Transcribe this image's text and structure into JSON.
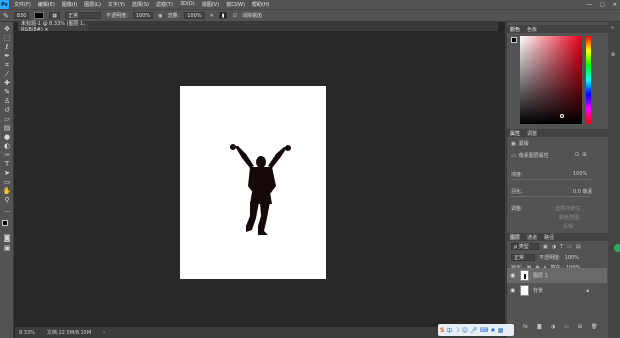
{
  "app": {
    "logo": "Ps",
    "menu": [
      "文件(F)",
      "编辑(E)",
      "图像(I)",
      "图层(L)",
      "文字(Y)",
      "选择(S)",
      "滤镜(T)",
      "3D(D)",
      "视图(V)",
      "窗口(W)",
      "帮助(H)"
    ],
    "window_buttons": [
      "—",
      "□",
      "✕"
    ]
  },
  "options_bar": {
    "brush_size": "830",
    "mode": "正常",
    "opacity_label": "不透明度:",
    "opacity_value": "100%",
    "flow_label": "流量:",
    "flow_value": "100%",
    "checkbox_label": "消除锯齿"
  },
  "document": {
    "tab_title": "未标题-1 @ 8.33% (图层 1, RGB/8#) ×",
    "zoom": "8.33%",
    "doc_info": "文档:22.5M/8.15M"
  },
  "color_panel": {
    "tabs": [
      "颜色",
      "色板"
    ]
  },
  "properties_panel": {
    "tabs": [
      "属性",
      "调整"
    ],
    "section": "像素图层属性",
    "sub_label": "蒙版",
    "density_label": "浓度:",
    "density_value": "100%",
    "feather_label": "羽化:",
    "feather_value": "0.0 像素",
    "refine_label": "调整:",
    "buttons": [
      "选择并遮住...",
      "颜色范围...",
      "反相"
    ]
  },
  "layers_panel": {
    "tabs": [
      "图层",
      "通道",
      "路径"
    ],
    "filter_label": "ρ 类型",
    "blend_mode": "正常",
    "opacity_label": "不透明度:",
    "opacity_value": "100%",
    "lock_label": "锁定:",
    "fill_label": "填充:",
    "fill_value": "100%",
    "layers": [
      {
        "name": "图层 1"
      },
      {
        "name": "背景"
      }
    ]
  },
  "tools": [
    "move-icon",
    "marquee-icon",
    "lasso-icon",
    "quick-select-icon",
    "crop-icon",
    "eyedropper-icon",
    "healing-icon",
    "brush-icon",
    "stamp-icon",
    "history-brush-icon",
    "eraser-icon",
    "gradient-icon",
    "blur-icon",
    "dodge-icon",
    "pen-icon",
    "type-icon",
    "path-select-icon",
    "shape-icon",
    "hand-icon",
    "zoom-icon"
  ],
  "colors": {
    "accent": "#31a8ff",
    "panel_bg": "#535353",
    "canvas_bg": "#282828",
    "silhouette": "#160a08"
  }
}
